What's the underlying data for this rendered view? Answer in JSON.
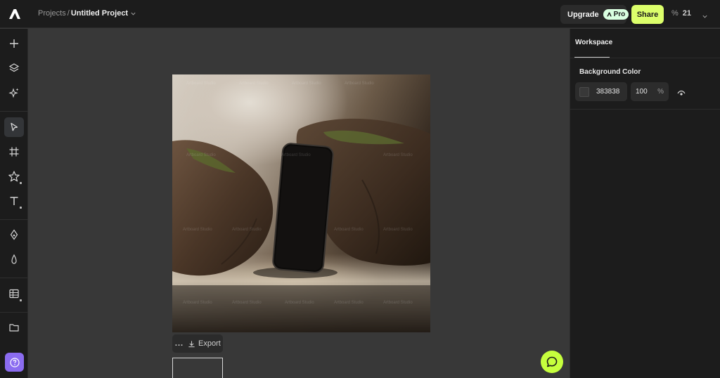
{
  "header": {
    "logo": "brand-logo-icon",
    "breadcrumb_root": "Projects",
    "breadcrumb_sep": "/",
    "project_name": "Untitled Project",
    "upgrade_label": "Upgrade",
    "pro_label": "Pro",
    "share_label": "Share",
    "zoom_symbol": "%",
    "zoom_value": "21"
  },
  "toolbar": {
    "tools": [
      "add-icon",
      "layers-icon",
      "ai-sparkle-icon",
      "select-pointer-icon",
      "frame-icon",
      "shapes-star-icon",
      "text-icon",
      "pen-icon",
      "color-drop-icon",
      "table-icon",
      "folder-icon",
      "help-icon"
    ],
    "active_tool": "select-pointer-icon"
  },
  "canvas": {
    "background": "#383838",
    "watermark_text": "Artboard Studio",
    "export_menu_label": "...",
    "export_label": "Export"
  },
  "panel": {
    "tab_label": "Workspace",
    "background_color_label": "Background Color",
    "color_hex": "383838",
    "opacity_value": "100",
    "opacity_unit": "%"
  },
  "colors": {
    "accent_share": "#dcff6b",
    "accent_chat": "#c6ff3d",
    "help_button": "#8b6cf0",
    "pro_badge": "#d9ffe0"
  }
}
